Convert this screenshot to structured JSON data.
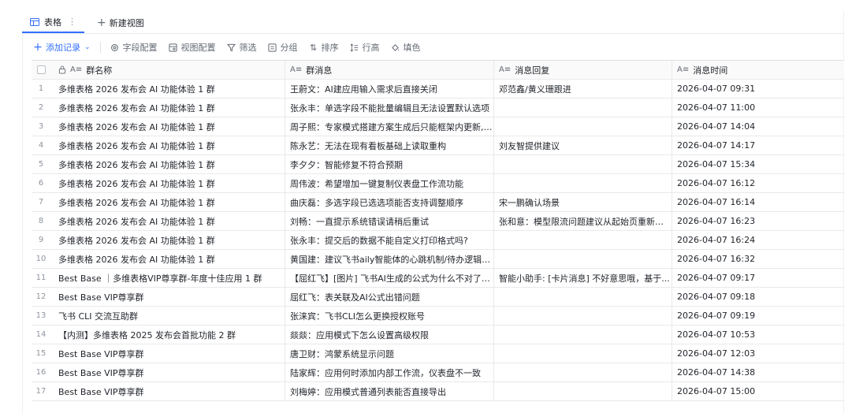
{
  "tabs": [
    {
      "label": "表格",
      "icon": "table-grid-icon",
      "active": true
    },
    {
      "label": "新建视图",
      "icon": "plus-icon",
      "active": false
    }
  ],
  "toolbar": {
    "add_record": "添加记录",
    "field_config": "字段配置",
    "view_config": "视图配置",
    "filter": "筛选",
    "group": "分组",
    "sort": "排序",
    "row_height": "行高",
    "fill_color": "填色"
  },
  "columns": {
    "name": "群名称",
    "message": "群消息",
    "reply": "消息回复",
    "time": "消息时间"
  },
  "rows": [
    {
      "idx": "1",
      "name": "多维表格 2026 发布会 AI 功能体验 1 群",
      "message": "王蔚文：AI建应用输入需求后直接关闭",
      "reply": "邓范鑫/黄义珊跟进",
      "time": "2026-04-07 09:31"
    },
    {
      "idx": "2",
      "name": "多维表格 2026 发布会 AI 功能体验 1 群",
      "message": "张永丰：单选字段不能批量编辑且无法设置默认选项",
      "reply": "",
      "time": "2026-04-07 11:00"
    },
    {
      "idx": "3",
      "name": "多维表格 2026 发布会 AI 功能体验 1 群",
      "message": "周子熙：专家模式搭建方案生成后只能框架内更新, ...",
      "reply": "",
      "time": "2026-04-07 14:04"
    },
    {
      "idx": "4",
      "name": "多维表格 2026 发布会 AI 功能体验 1 群",
      "message": "陈永艺：无法在现有看板基础上读取重构",
      "reply": "刘友智提供建议",
      "time": "2026-04-07 14:17"
    },
    {
      "idx": "5",
      "name": "多维表格 2026 发布会 AI 功能体验 1 群",
      "message": "李夕夕：智能修复不符合预期",
      "reply": "",
      "time": "2026-04-07 15:34"
    },
    {
      "idx": "6",
      "name": "多维表格 2026 发布会 AI 功能体验 1 群",
      "message": "周伟波：希望增加一键复制仪表盘工作流功能",
      "reply": "",
      "time": "2026-04-07 16:12"
    },
    {
      "idx": "7",
      "name": "多维表格 2026 发布会 AI 功能体验 1 群",
      "message": "曲庆磊：多选字段已选选项能否支持调整顺序",
      "reply": "宋一鹏确认场景",
      "time": "2026-04-07 16:14"
    },
    {
      "idx": "8",
      "name": "多维表格 2026 发布会 AI 功能体验 1 群",
      "message": "刘畅：一直提示系统错误请稍后重试",
      "reply": "张和意：模型限流问题建议从起始页重新搭建",
      "time": "2026-04-07 16:23"
    },
    {
      "idx": "9",
      "name": "多维表格 2026 发布会 AI 功能体验 1 群",
      "message": "张永丰：提交后的数据不能自定义打印格式吗?",
      "reply": "",
      "time": "2026-04-07 16:24"
    },
    {
      "idx": "10",
      "name": "多维表格 2026 发布会 AI 功能体验 1 群",
      "message": "黄国建：建议飞书aily智能体的心跳机制/待办逻辑和...",
      "reply": "",
      "time": "2026-04-07 16:32"
    },
    {
      "idx": "11",
      "name": "Best Base ｜多维表格VIP尊享群-年度十佳应用 1 群",
      "message": "【屈红飞】[图片] 飞书AI生成的公式为什么不对了? ...",
      "reply": "智能小助手: [卡片消息] 不好意思哦，基于...",
      "time": "2026-04-07 09:17"
    },
    {
      "idx": "12",
      "name": "Best Base VIP尊享群",
      "message": "屈红飞：表关联及AI公式出错问题",
      "reply": "",
      "time": "2026-04-07 09:18"
    },
    {
      "idx": "13",
      "name": "飞书 CLI 交流互助群",
      "message": "张涞宾：飞书CLI怎么更换授权账号",
      "reply": "",
      "time": "2026-04-07 09:19"
    },
    {
      "idx": "14",
      "name": "【内测】多维表格 2025 发布会首批功能 2 群",
      "message": "燚燚：应用模式下怎么设置高级权限",
      "reply": "",
      "time": "2026-04-07 10:53"
    },
    {
      "idx": "15",
      "name": "Best Base VIP尊享群",
      "message": "唐卫财：鸿蒙系统显示问题",
      "reply": "",
      "time": "2026-04-07 12:03"
    },
    {
      "idx": "16",
      "name": "Best Base VIP尊享群",
      "message": "陆家辉：应用何时添加内部工作流，仪表盘不一致",
      "reply": "",
      "time": "2026-04-07 14:38"
    },
    {
      "idx": "17",
      "name": "Best Base VIP尊享群",
      "message": "刘梅婷：应用模式普通列表能否直接导出",
      "reply": "",
      "time": "2026-04-07 15:00"
    }
  ]
}
